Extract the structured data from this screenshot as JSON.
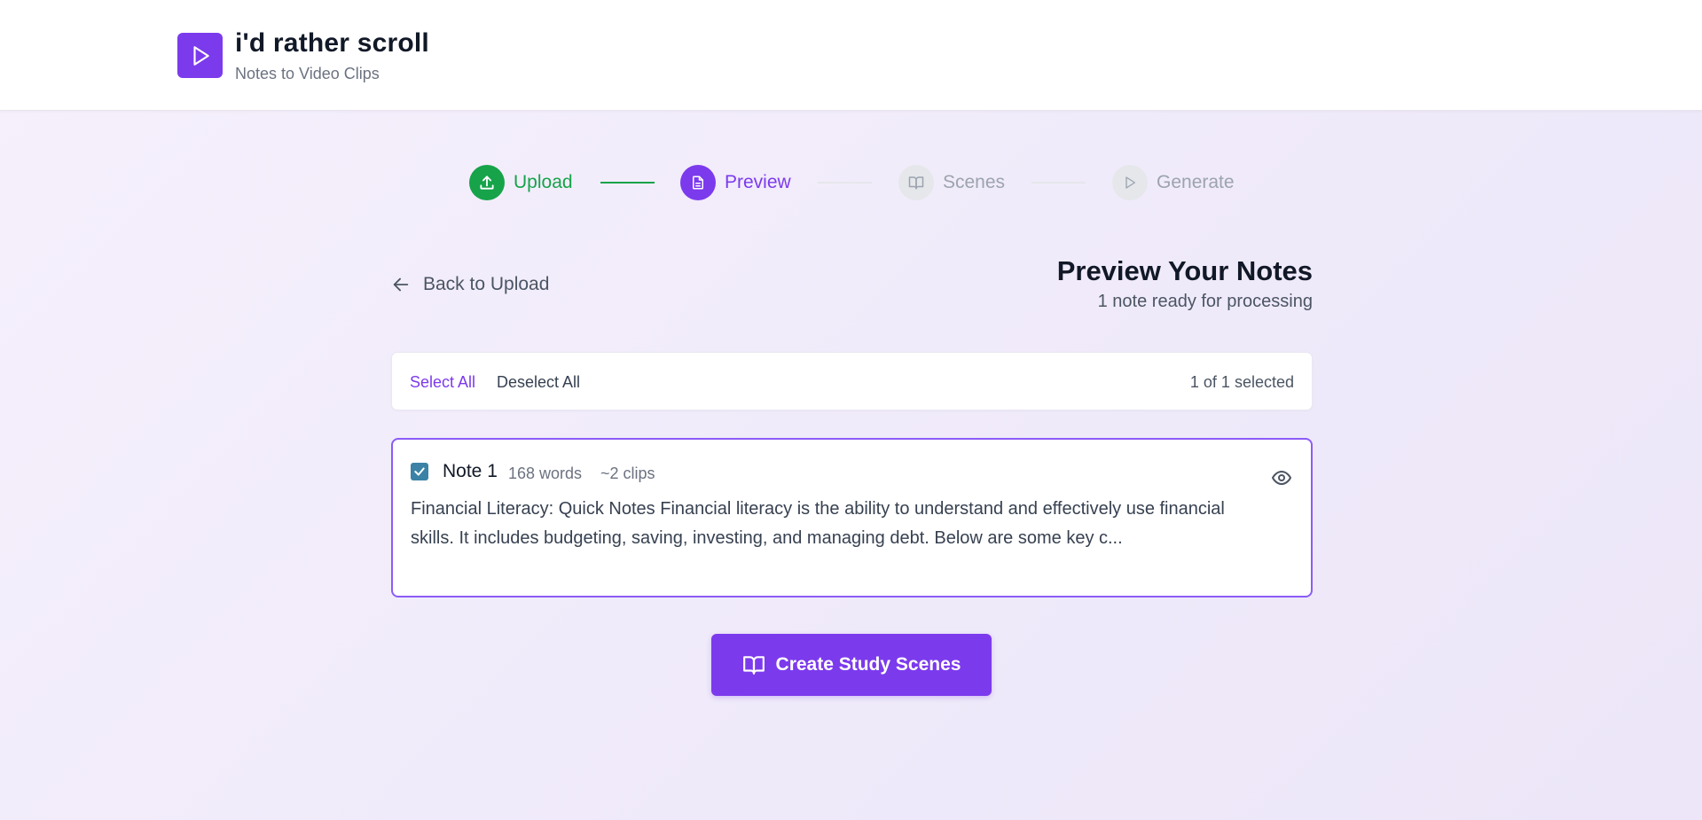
{
  "app": {
    "title": "i'd rather scroll",
    "subtitle": "Notes to Video Clips",
    "brand_color": "#7c3aed"
  },
  "stepper": {
    "steps": [
      {
        "label": "Upload",
        "status": "complete",
        "icon": "upload-icon",
        "color": "#16a34a"
      },
      {
        "label": "Preview",
        "status": "active",
        "icon": "document-icon",
        "color": "#7c3aed"
      },
      {
        "label": "Scenes",
        "status": "pending",
        "icon": "book-icon",
        "color": "#9ca3af"
      },
      {
        "label": "Generate",
        "status": "pending",
        "icon": "play-icon",
        "color": "#9ca3af"
      }
    ]
  },
  "header": {
    "back_label": "Back to Upload",
    "title": "Preview Your Notes",
    "subtitle": "1 note ready for processing"
  },
  "selection": {
    "select_all": "Select All",
    "deselect_all": "Deselect All",
    "count": "1 of 1 selected"
  },
  "notes": [
    {
      "title": "Note 1",
      "words": "168 words",
      "clips": "~2 clips",
      "checked": true,
      "preview": "Financial Literacy: Quick Notes Financial literacy is the ability to understand and effectively use financial skills. It includes budgeting, saving, investing, and managing debt. Below are some key c..."
    }
  ],
  "cta": {
    "label": "Create Study Scenes",
    "icon": "book-icon"
  }
}
